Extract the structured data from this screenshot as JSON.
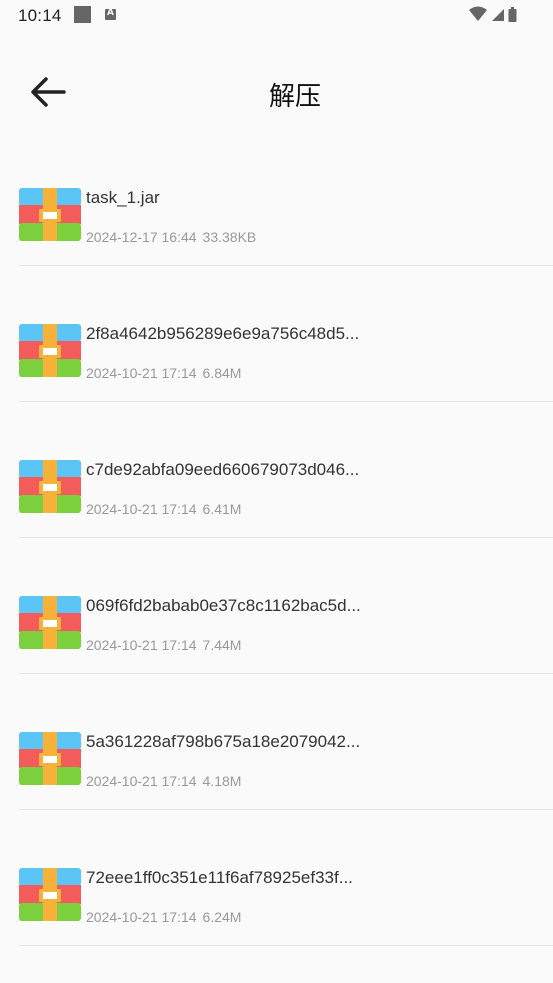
{
  "status_bar": {
    "time": "10:14"
  },
  "header": {
    "title": "解压"
  },
  "files": [
    {
      "name": "task_1.jar",
      "date": "2024-12-17 16:44",
      "size": "33.38KB"
    },
    {
      "name": "2f8a4642b956289e6e9a756c48d5...",
      "date": "2024-10-21 17:14",
      "size": "6.84M"
    },
    {
      "name": "c7de92abfa09eed660679073d046...",
      "date": "2024-10-21 17:14",
      "size": "6.41M"
    },
    {
      "name": "069f6fd2babab0e37c8c1162bac5d...",
      "date": "2024-10-21 17:14",
      "size": "7.44M"
    },
    {
      "name": "5a361228af798b675a18e2079042...",
      "date": "2024-10-21 17:14",
      "size": "4.18M"
    },
    {
      "name": "72eee1ff0c351e11f6af78925ef33f...",
      "date": "2024-10-21 17:14",
      "size": "6.24M"
    }
  ],
  "icons": {
    "back": "arrow-left-icon",
    "archive": "archive-icon",
    "wifi": "wifi-icon",
    "signal": "signal-icon",
    "battery": "battery-icon",
    "notification": "notification-icon",
    "keyboard": "keyboard-icon"
  },
  "colors": {
    "background": "#fafafa",
    "archive_top": "#5bc6f5",
    "archive_middle": "#f45b5b",
    "archive_bottom": "#7ccf3d",
    "archive_strap": "#f7b23b",
    "meta_text": "#999999",
    "divider": "#e6e6e6"
  }
}
